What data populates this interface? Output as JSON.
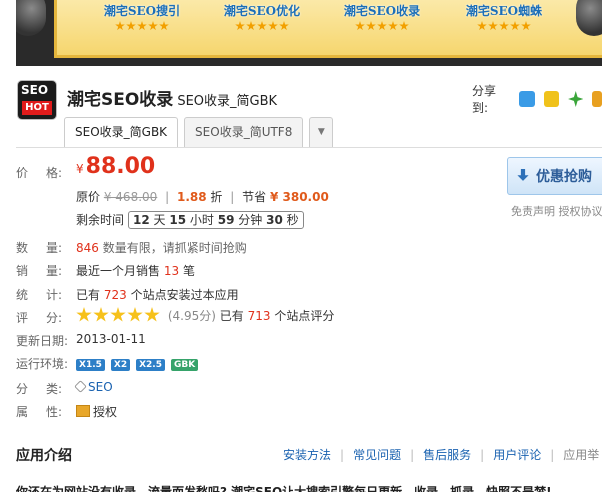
{
  "banner": {
    "items": [
      "潮宅SEO搜引",
      "潮宅SEO优化",
      "潮宅SEO收录",
      "潮宅SEO蜘蛛"
    ]
  },
  "logo": {
    "line1": "SEO",
    "line2": "HOT"
  },
  "title": {
    "main": "潮宅SEO收录",
    "sub": "SEO收录_简GBK"
  },
  "share": {
    "label": "分享到:"
  },
  "tabs": [
    "SEO收录_简GBK",
    "SEO收录_简UTF8"
  ],
  "price": {
    "label_a": "价",
    "label_b": "格:",
    "currency": "¥",
    "value": "88.00",
    "orig_label": "原价",
    "orig_value": "¥ 468.00",
    "discount_value": "1.88",
    "discount_unit": "折",
    "save_label": "节省",
    "save_value": "¥ 380.00",
    "remain_label": "剩余时间",
    "timer": {
      "d": "12",
      "d_u": "天",
      "h": "15",
      "h_u": "小时",
      "m": "59",
      "m_u": "分钟",
      "s": "30",
      "s_u": "秒"
    }
  },
  "buy": {
    "label": "优惠抢购"
  },
  "disclaimer": "免责声明 授权协议",
  "rows": {
    "qty": {
      "a": "数",
      "b": "量:",
      "num": "846",
      "text": "数量有限，请抓紧时间抢购"
    },
    "sales": {
      "a": "销",
      "b": "量:",
      "pre": "最近一个月销售",
      "num": "13",
      "post": "笔"
    },
    "stats": {
      "a": "统",
      "b": "计:",
      "pre": "已有",
      "num": "723",
      "post": "个站点安装过本应用"
    },
    "rating": {
      "a": "评",
      "b": "分:",
      "score": "(4.95分)",
      "pre": "已有",
      "num": "713",
      "post": "个站点评分"
    },
    "date": {
      "label": "更新日期:",
      "value": "2013-01-11"
    },
    "env": {
      "label": "运行环境:",
      "badges": [
        "X1.5",
        "X2",
        "X2.5",
        "GBK"
      ]
    },
    "category": {
      "a": "分",
      "b": "类:",
      "value": "SEO"
    },
    "property": {
      "a": "属",
      "b": "性:",
      "value": "授权"
    }
  },
  "intro": {
    "title": "应用介绍",
    "links": [
      "安装方法",
      "常见问题",
      "售后服务",
      "用户评论",
      "应用举"
    ]
  },
  "cut_text": "你还在为网站没有收录，流量而发愁吗? 潮宅SEO让大搜索引擎每日更新，收录、抓录、快照不是梦!"
}
